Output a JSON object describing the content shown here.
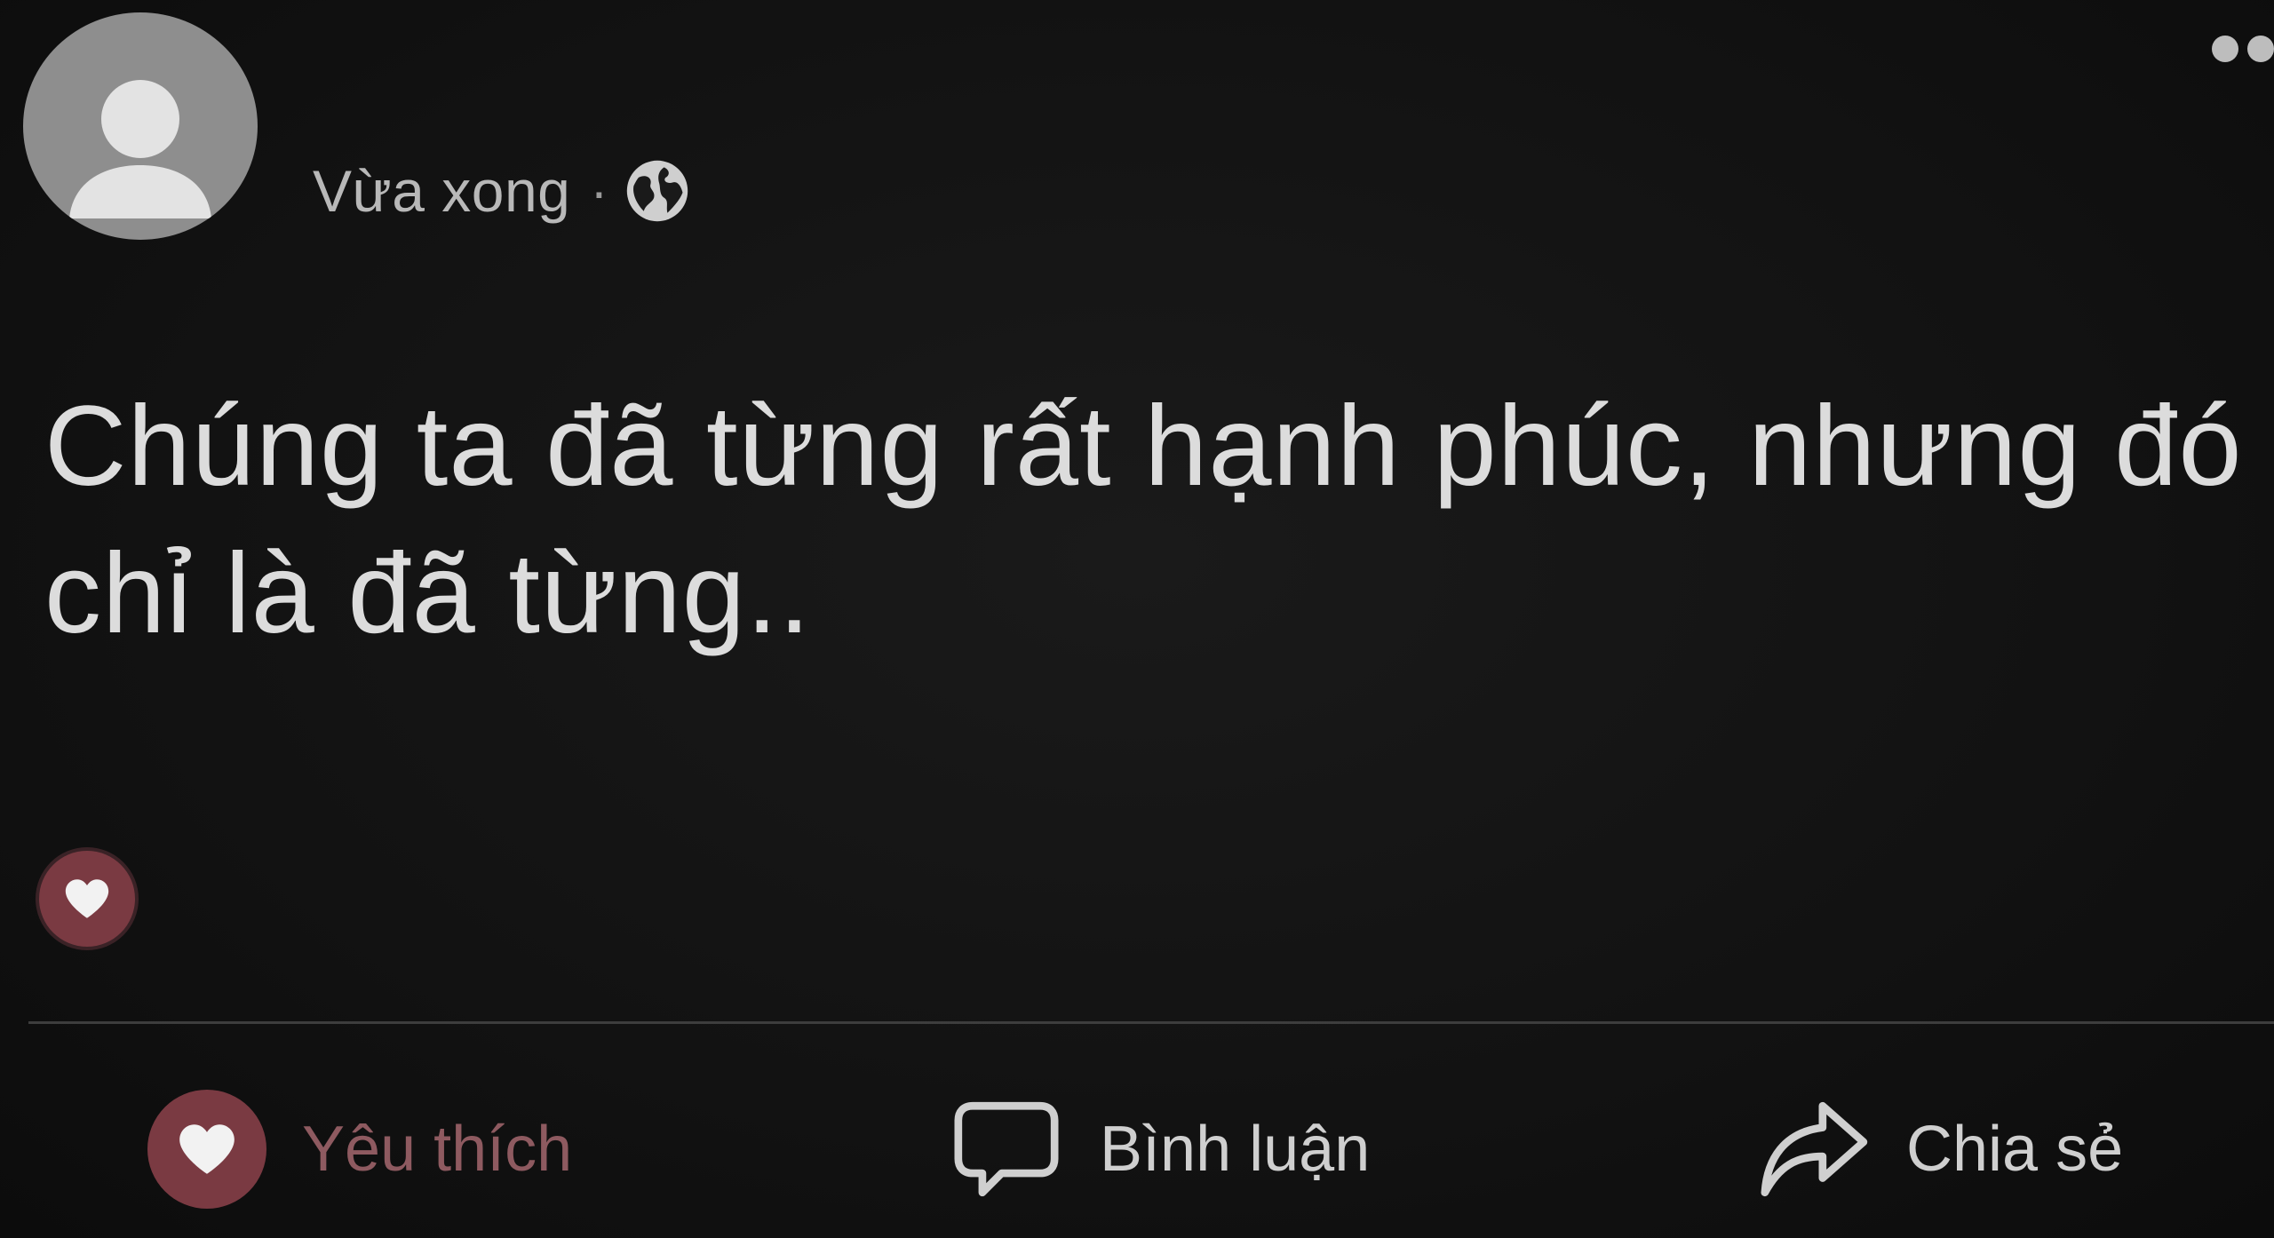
{
  "post": {
    "time": "Vừa xong",
    "separator": "·",
    "privacy_icon": "globe-icon",
    "text": "Chúng ta đã từng rất hạnh phúc, nhưng đó chỉ là đã từng..",
    "reaction_icon": "heart-icon"
  },
  "actions": {
    "like_label": "Yêu thích",
    "comment_label": "Bình luận",
    "share_label": "Chia sẻ"
  },
  "colors": {
    "background": "#111111",
    "text": "#dcdcdc",
    "like_accent": "#7a3a42",
    "like_text": "#8e5a60"
  }
}
